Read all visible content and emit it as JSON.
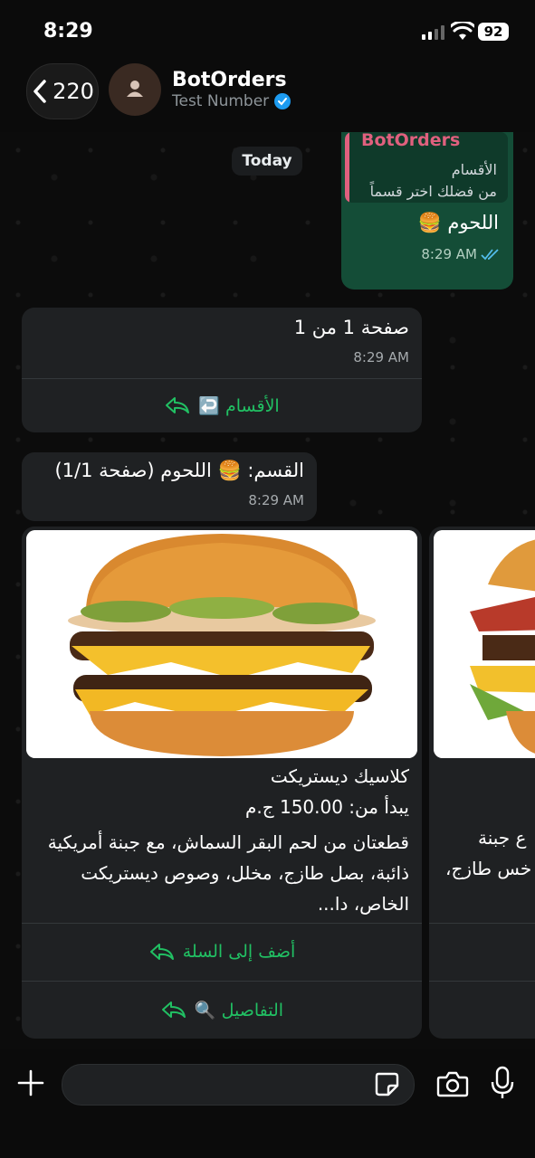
{
  "status": {
    "time": "8:29",
    "battery": "92"
  },
  "header": {
    "back_count": "220",
    "contact_name": "BotOrders",
    "contact_subtitle": "Test Number"
  },
  "chat": {
    "date_chip": "Today",
    "outgoing": {
      "quote_author": "BotOrders",
      "quote_title": "الأقسام",
      "quote_text": "من فضلك اختر قسماً",
      "text": "اللحوم 🍔",
      "time": "8:29 AM"
    },
    "page_msg": {
      "text": "صفحة 1 من 1",
      "time": "8:29 AM",
      "button": "↩️ الأقسام"
    },
    "category_msg": {
      "text": "القسم: 🍔 اللحوم (صفحة 1/1)",
      "time": "8:29 AM"
    },
    "product_card": {
      "name": "كلاسيك ديستريكت",
      "price": "يبدأ من: 150.00 ج.م",
      "description": "قطعتان من لحم البقر السماش، مع جبنة أمريكية ذائبة، بصل طازج، مخلل، وصوص ديستريكت الخاص، دا...",
      "button_add": "أضف إلى السلة",
      "button_details": "🔍 التفاصيل"
    },
    "next_card_partial": {
      "line1": "ع جبنة",
      "line2": "خس طازج،"
    }
  },
  "colors": {
    "accent_green": "#21c063",
    "outgoing_bg": "#144d37",
    "incoming_bg": "#1f2123",
    "quote_bar": "#e0607e"
  }
}
